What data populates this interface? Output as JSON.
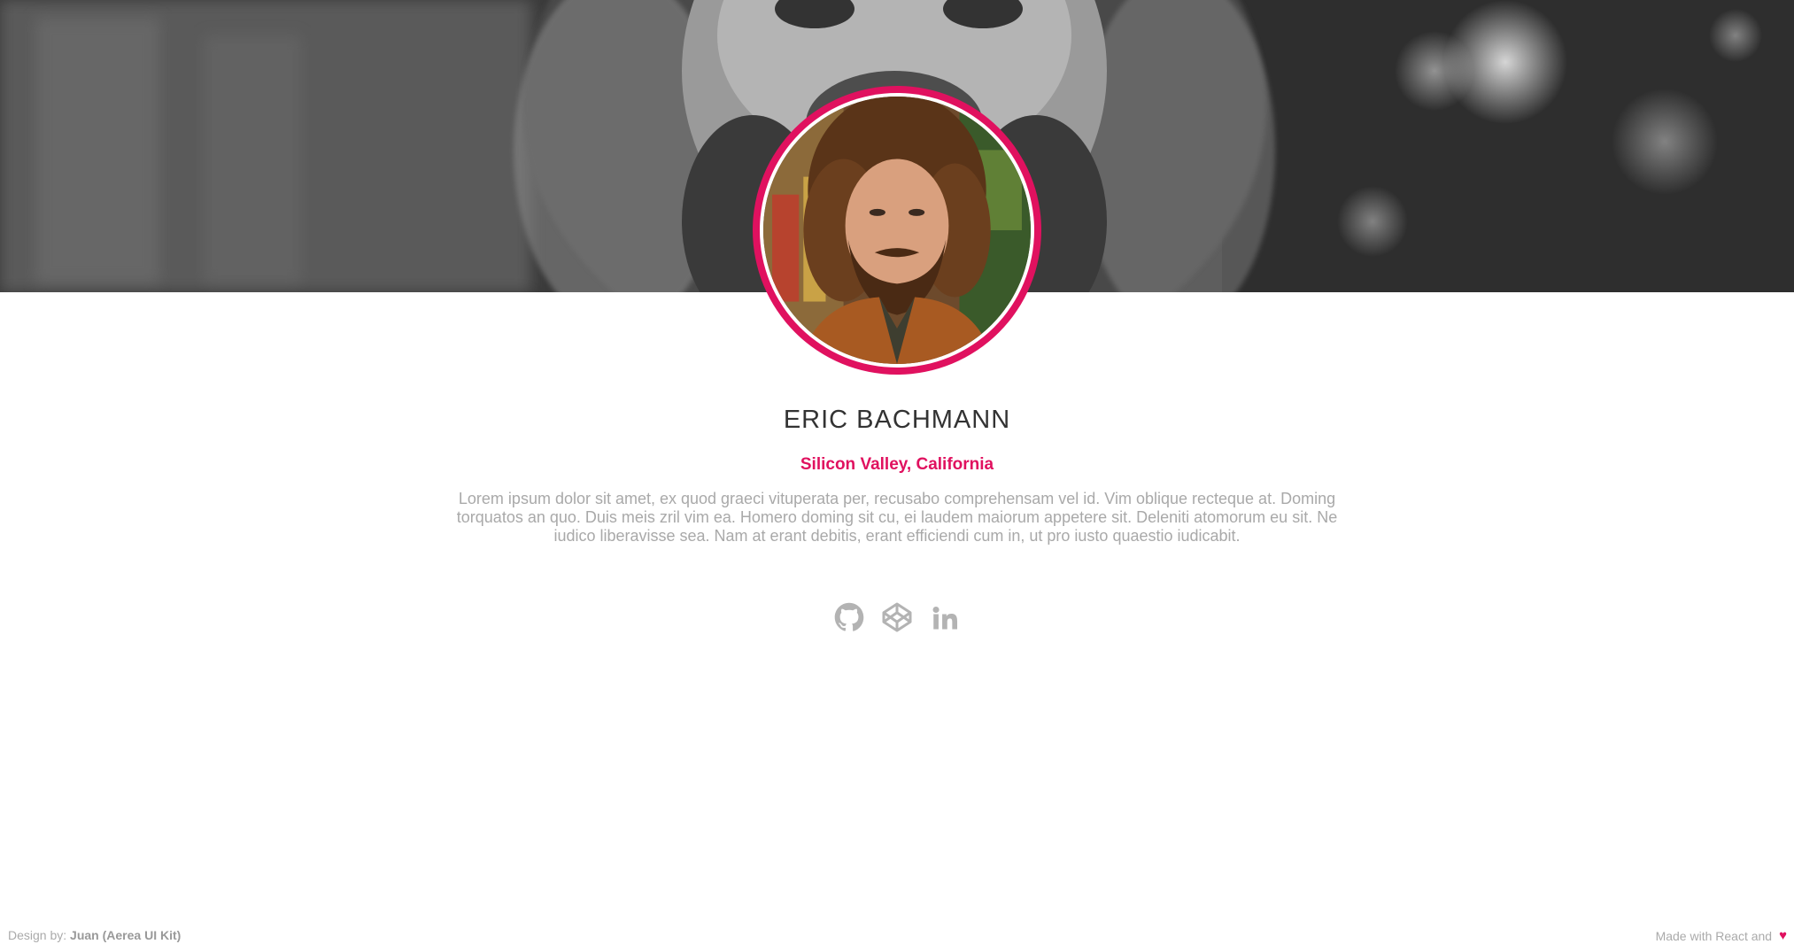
{
  "profile": {
    "name": "ERIC BACHMANN",
    "location": "Silicon Valley, California",
    "bio": "Lorem ipsum dolor sit amet, ex quod graeci vituperata per, recusabo comprehensam vel id. Vim oblique recteque at. Doming torquatos an quo. Duis meis zril vim ea. Homero doming sit cu, ei laudem maiorum appetere sit. Deleniti atomorum eu sit. Ne iudico liberavisse sea. Nam at erant debitis, erant efficiendi cum in, ut pro iusto quaestio iudicabit."
  },
  "socials": [
    {
      "icon": "github-icon"
    },
    {
      "icon": "codepen-icon"
    },
    {
      "icon": "linkedin-icon"
    }
  ],
  "footer": {
    "design_label": "Design by:",
    "designer": "Juan (Aerea UI Kit)",
    "made_with": "Made with React and",
    "heart_icon": "heart-icon"
  },
  "colors": {
    "accent": "#e0115f",
    "text_muted": "#a9a9a9",
    "name_text": "#333333"
  }
}
